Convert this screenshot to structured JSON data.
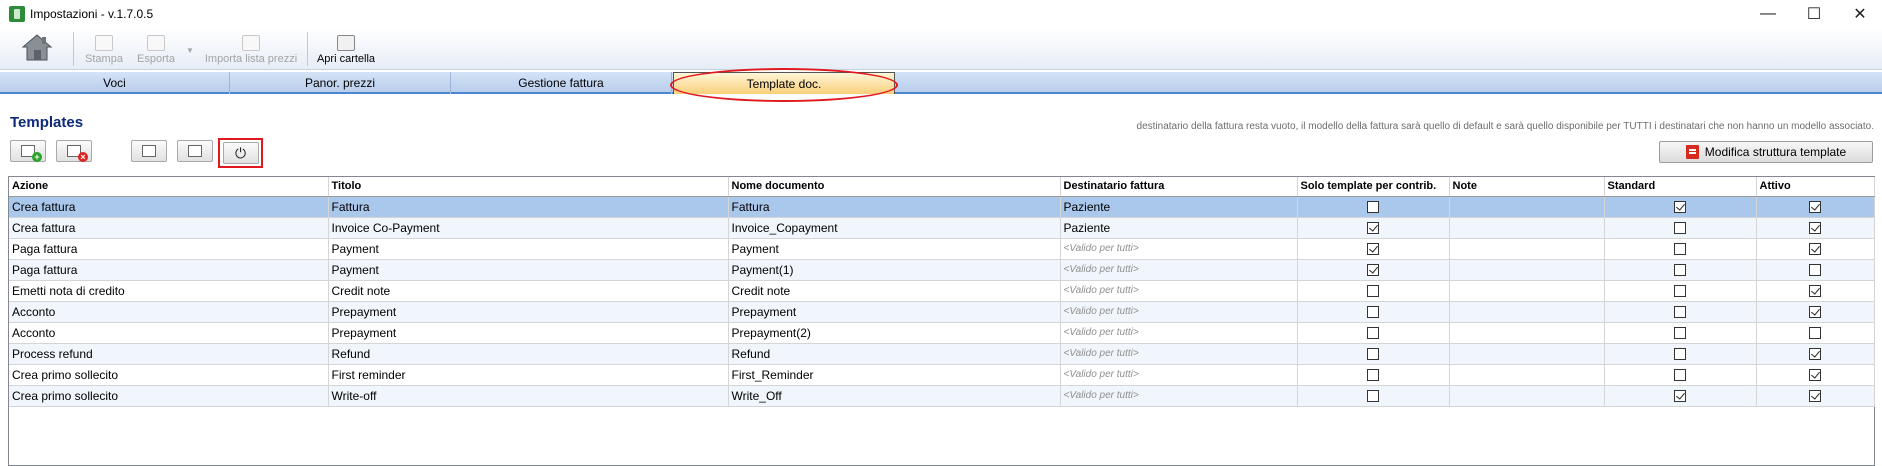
{
  "window": {
    "title": "Impostazioni  -  v.1.7.0.5",
    "controls": {
      "minimize": "—",
      "maximize": "☐",
      "close": "✕"
    }
  },
  "toolbar": {
    "home_icon": "home-icon",
    "stampa": "Stampa",
    "esporta": "Esporta",
    "importa": "Importa lista prezzi",
    "apri": "Apri cartella"
  },
  "tabs": [
    {
      "label": "Voci"
    },
    {
      "label": "Panor. prezzi"
    },
    {
      "label": "Gestione fattura"
    },
    {
      "label": "Template doc."
    }
  ],
  "section": {
    "title": "Templates",
    "note": "destinatario della fattura resta vuoto, il modello della fattura sarà quello di default e sarà quello disponibile per TUTTI i destinatari che non hanno un modello associato.",
    "modifica_label": "Modifica struttura template"
  },
  "table": {
    "columns": [
      "Azione",
      "Titolo",
      "Nome documento",
      "Destinatario fattura",
      "Solo template per contrib.",
      "Note",
      "Standard",
      "Attivo"
    ],
    "rows": [
      {
        "azione": "Crea fattura",
        "titolo": "Fattura",
        "nome": "Fattura",
        "destinatario": "Paziente",
        "solo": false,
        "note": "",
        "standard": true,
        "attivo": true
      },
      {
        "azione": "Crea fattura",
        "titolo": "Invoice Co-Payment",
        "nome": "Invoice_Copayment",
        "destinatario": "Paziente",
        "solo": true,
        "note": "",
        "standard": false,
        "attivo": true
      },
      {
        "azione": "Paga fattura",
        "titolo": "Payment",
        "nome": "Payment",
        "destinatario": "<Valido per tutti>",
        "solo": true,
        "note": "",
        "standard": false,
        "attivo": true
      },
      {
        "azione": "Paga fattura",
        "titolo": "Payment",
        "nome": "Payment(1)",
        "destinatario": "<Valido per tutti>",
        "solo": true,
        "note": "",
        "standard": false,
        "attivo": false
      },
      {
        "azione": "Emetti nota di credito",
        "titolo": "Credit note",
        "nome": "Credit note",
        "destinatario": "<Valido per tutti>",
        "solo": false,
        "note": "",
        "standard": false,
        "attivo": true
      },
      {
        "azione": "Acconto",
        "titolo": "Prepayment",
        "nome": "Prepayment",
        "destinatario": "<Valido per tutti>",
        "solo": false,
        "note": "",
        "standard": false,
        "attivo": true
      },
      {
        "azione": "Acconto",
        "titolo": "Prepayment",
        "nome": "Prepayment(2)",
        "destinatario": "<Valido per tutti>",
        "solo": false,
        "note": "",
        "standard": false,
        "attivo": false
      },
      {
        "azione": "Process refund",
        "titolo": "Refund",
        "nome": "Refund",
        "destinatario": "<Valido per tutti>",
        "solo": false,
        "note": "",
        "standard": false,
        "attivo": true
      },
      {
        "azione": "Crea primo sollecito",
        "titolo": "First reminder",
        "nome": "First_Reminder",
        "destinatario": "<Valido per tutti>",
        "solo": false,
        "note": "",
        "standard": false,
        "attivo": true
      },
      {
        "azione": "Crea primo sollecito",
        "titolo": "Write-off",
        "nome": "Write_Off",
        "destinatario": "<Valido per tutti>",
        "solo": false,
        "note": "",
        "standard": true,
        "attivo": true
      }
    ]
  }
}
